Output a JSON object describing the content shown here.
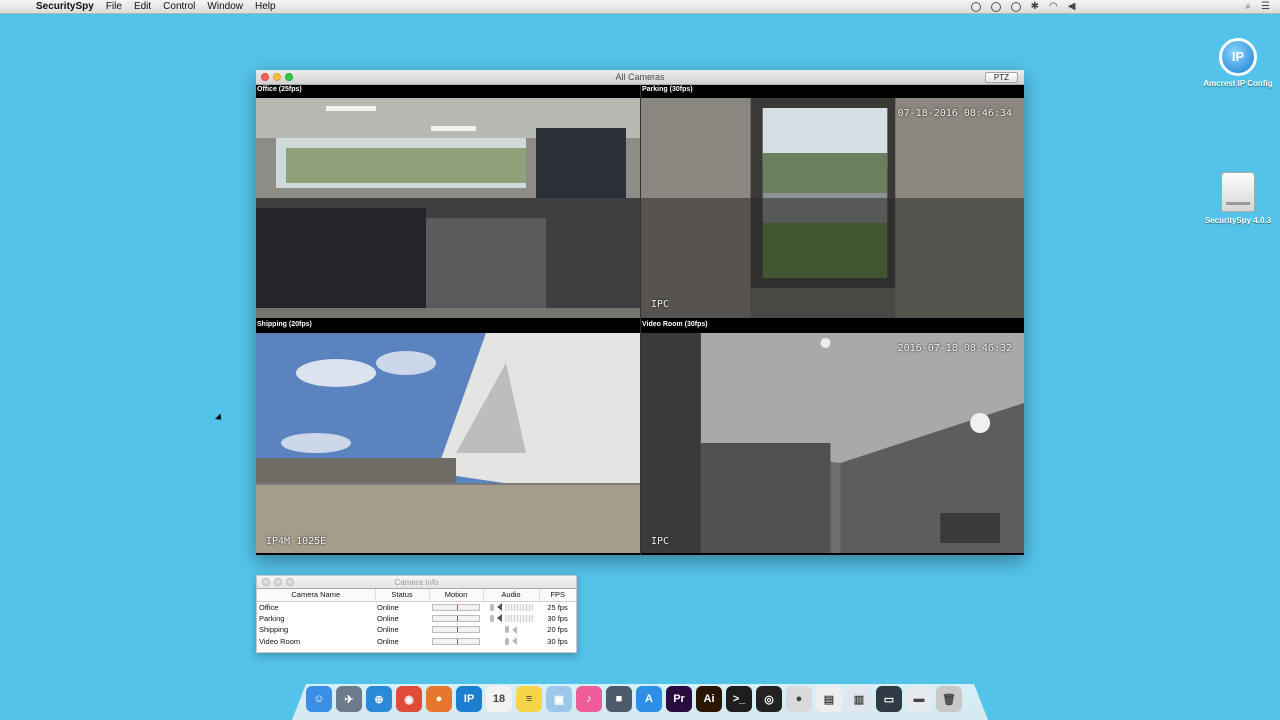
{
  "menubar": {
    "app_name": "SecuritySpy",
    "items": [
      "File",
      "Edit",
      "Control",
      "Window",
      "Help"
    ]
  },
  "desktop": {
    "icons": [
      {
        "label": "Amcrest IP Config",
        "icon": "ip-config-icon",
        "glyph": "IP"
      },
      {
        "label": "SecuritySpy 4.0.3",
        "icon": "disk-image-icon"
      }
    ]
  },
  "main_window": {
    "title": "All Cameras",
    "ptz_label": "PTZ",
    "cameras": [
      {
        "label": "Office (25fps)",
        "osd": ""
      },
      {
        "label": "Parking (30fps)",
        "osd": "07-18-2016 08:46:34",
        "osd2": "IPC"
      },
      {
        "label": "Shipping (20fps)",
        "osd": "",
        "osd2": "IP4M-1025E"
      },
      {
        "label": "Video Room (30fps)",
        "osd": "2016-07-18 08:46:32",
        "osd2": "IPC"
      }
    ]
  },
  "info_window": {
    "title": "Camera Info",
    "columns": [
      "Camera Name",
      "Status",
      "Motion",
      "Audio",
      "FPS"
    ],
    "rows": [
      {
        "name": "Office",
        "status": "Online",
        "fps": "25 fps"
      },
      {
        "name": "Parking",
        "status": "Online",
        "fps": "30 fps"
      },
      {
        "name": "Shipping",
        "status": "Online",
        "fps": "20 fps"
      },
      {
        "name": "Video Room",
        "status": "Online",
        "fps": "30 fps"
      }
    ]
  },
  "dock": {
    "apps": [
      {
        "name": "finder",
        "color": "#3a8ee6",
        "glyph": "☺"
      },
      {
        "name": "launchpad",
        "color": "#6b7b8c",
        "glyph": "✈"
      },
      {
        "name": "safari",
        "color": "#2b8ad8",
        "glyph": "⊕"
      },
      {
        "name": "chrome",
        "color": "#e04b3a",
        "glyph": "◉"
      },
      {
        "name": "firefox",
        "color": "#e8772e",
        "glyph": "●"
      },
      {
        "name": "ip-config",
        "color": "#1b7fd1",
        "glyph": "IP"
      },
      {
        "name": "calendar",
        "color": "#f2f2f2",
        "glyph": "18"
      },
      {
        "name": "notes",
        "color": "#f5d547",
        "glyph": "≡"
      },
      {
        "name": "preview",
        "color": "#9cc7e8",
        "glyph": "▣"
      },
      {
        "name": "itunes",
        "color": "#ef5c9a",
        "glyph": "♪"
      },
      {
        "name": "facetime",
        "color": "#4b5b6b",
        "glyph": "■"
      },
      {
        "name": "app-store",
        "color": "#2e8fe8",
        "glyph": "A"
      },
      {
        "name": "premiere",
        "color": "#2a0b3d",
        "glyph": "Pr"
      },
      {
        "name": "illustrator",
        "color": "#2b1503",
        "glyph": "Ai"
      },
      {
        "name": "terminal",
        "color": "#1e1e1e",
        "glyph": ">_"
      },
      {
        "name": "quicktime",
        "color": "#222",
        "glyph": "◎"
      },
      {
        "name": "securityspy",
        "color": "#d9d9d9",
        "glyph": "●"
      },
      {
        "name": "document",
        "color": "#eeeeee",
        "glyph": "▤"
      },
      {
        "name": "folder",
        "color": "#dfe6ee",
        "glyph": "▥"
      },
      {
        "name": "display",
        "color": "#2f3a44",
        "glyph": "▭"
      },
      {
        "name": "downloads",
        "color": "#e6eaee",
        "glyph": "▬"
      },
      {
        "name": "trash",
        "color": "#c8c8c8",
        "glyph": "🗑"
      }
    ]
  }
}
